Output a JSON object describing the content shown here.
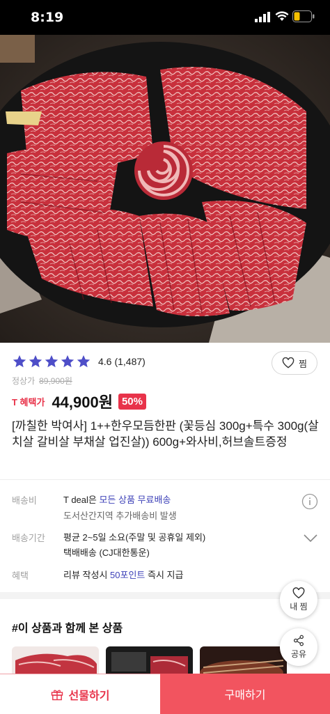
{
  "status_bar": {
    "time": "8:19"
  },
  "product": {
    "rating": 4.6,
    "rating_score": "4.6",
    "rating_count": "(1,487)",
    "wish_label": "찜",
    "original_price_label": "정상가",
    "original_price": "89,900원",
    "tbenefit_label": "T 혜택가",
    "price": "44,900원",
    "discount": "50%",
    "title": "[까칠한 박여사] 1++한우모듬한판 (꽃등심 300g+특수 300g(살치살 갈비살 부채살 업진살)) 600g+와사비,허브솔트증정"
  },
  "info": {
    "shipping": {
      "label": "배송비",
      "prefix": "T deal은 ",
      "highlight": "모든 상품 무료배송",
      "sub": "도서산간지역 추가배송비 발생"
    },
    "delivery": {
      "label": "배송기간",
      "value": "평균 2~5일 소요(주말 및 공휴일 제외)",
      "sub": "택배배송 (CJ대한통운)"
    },
    "benefit": {
      "label": "혜택",
      "prefix": "리뷰 작성시 ",
      "highlight": "50포인트",
      "suffix": " 즉시 지급"
    }
  },
  "related": {
    "title": "#이 상품과 함께 본 상품"
  },
  "fab": {
    "wish_label": "내 찜",
    "share_label": "공유"
  },
  "bottom_bar": {
    "gift_label": "선물하기",
    "buy_label": "구매하기"
  },
  "colors": {
    "accent": "#e8334a",
    "buy": "#f2545f",
    "star": "#4e4ec8",
    "highlight": "#3d41b8"
  }
}
